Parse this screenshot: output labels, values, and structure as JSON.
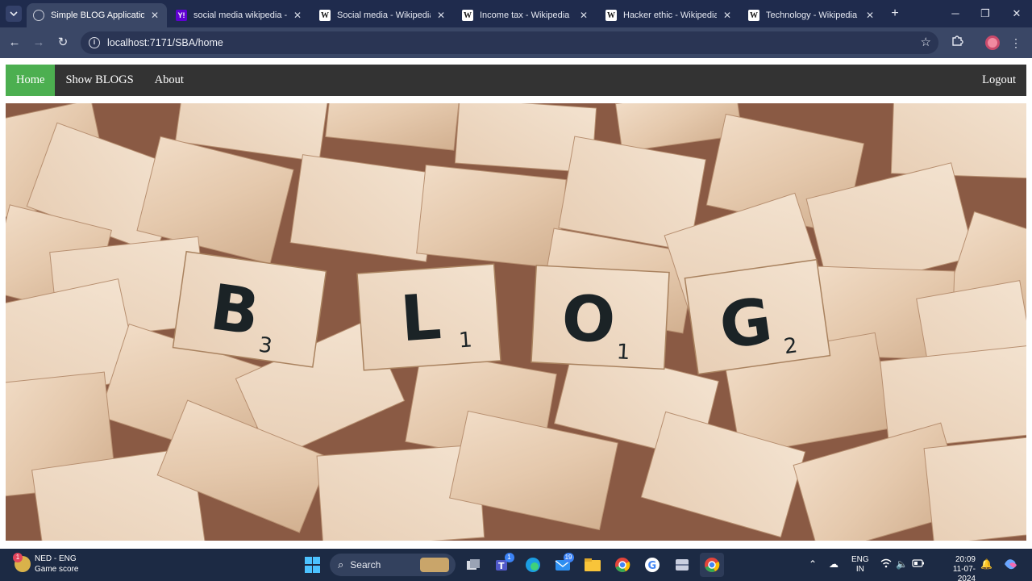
{
  "browser": {
    "tabs": [
      {
        "title": "Simple BLOG Application",
        "favicon": "globe-icon",
        "active": true
      },
      {
        "title": "social media wikipedia - Ya",
        "favicon": "yahoo-icon",
        "active": false
      },
      {
        "title": "Social media - Wikipedia",
        "favicon": "wikipedia-icon",
        "active": false
      },
      {
        "title": "Income tax - Wikipedia",
        "favicon": "wikipedia-icon",
        "active": false
      },
      {
        "title": "Hacker ethic - Wikipedia",
        "favicon": "wikipedia-icon",
        "active": false
      },
      {
        "title": "Technology - Wikipedia",
        "favicon": "wikipedia-icon",
        "active": false
      }
    ],
    "url": "localhost:7171/SBA/home",
    "favicon_glyphs": {
      "yahoo": "Y!",
      "wikipedia": "W"
    }
  },
  "navbar": {
    "links": [
      {
        "label": "Home",
        "active": true
      },
      {
        "label": "Show BLOGS",
        "active": false
      },
      {
        "label": "About",
        "active": false
      }
    ],
    "logout": "Logout",
    "active_color": "#4caf50",
    "bar_color": "#333333"
  },
  "hero": {
    "tiles": [
      {
        "letter": "B",
        "score": "3"
      },
      {
        "letter": "L",
        "score": "1"
      },
      {
        "letter": "O",
        "score": "1"
      },
      {
        "letter": "G",
        "score": "2"
      }
    ]
  },
  "taskbar": {
    "weather": {
      "line1": "NED - ENG",
      "line2": "Game score",
      "badge": "1"
    },
    "search_label": "Search",
    "badges": {
      "teams": "1",
      "mail": "19"
    },
    "tray": {
      "lang_line1": "ENG",
      "lang_line2": "IN",
      "time": "20:09",
      "date": "11-07-2024"
    }
  }
}
